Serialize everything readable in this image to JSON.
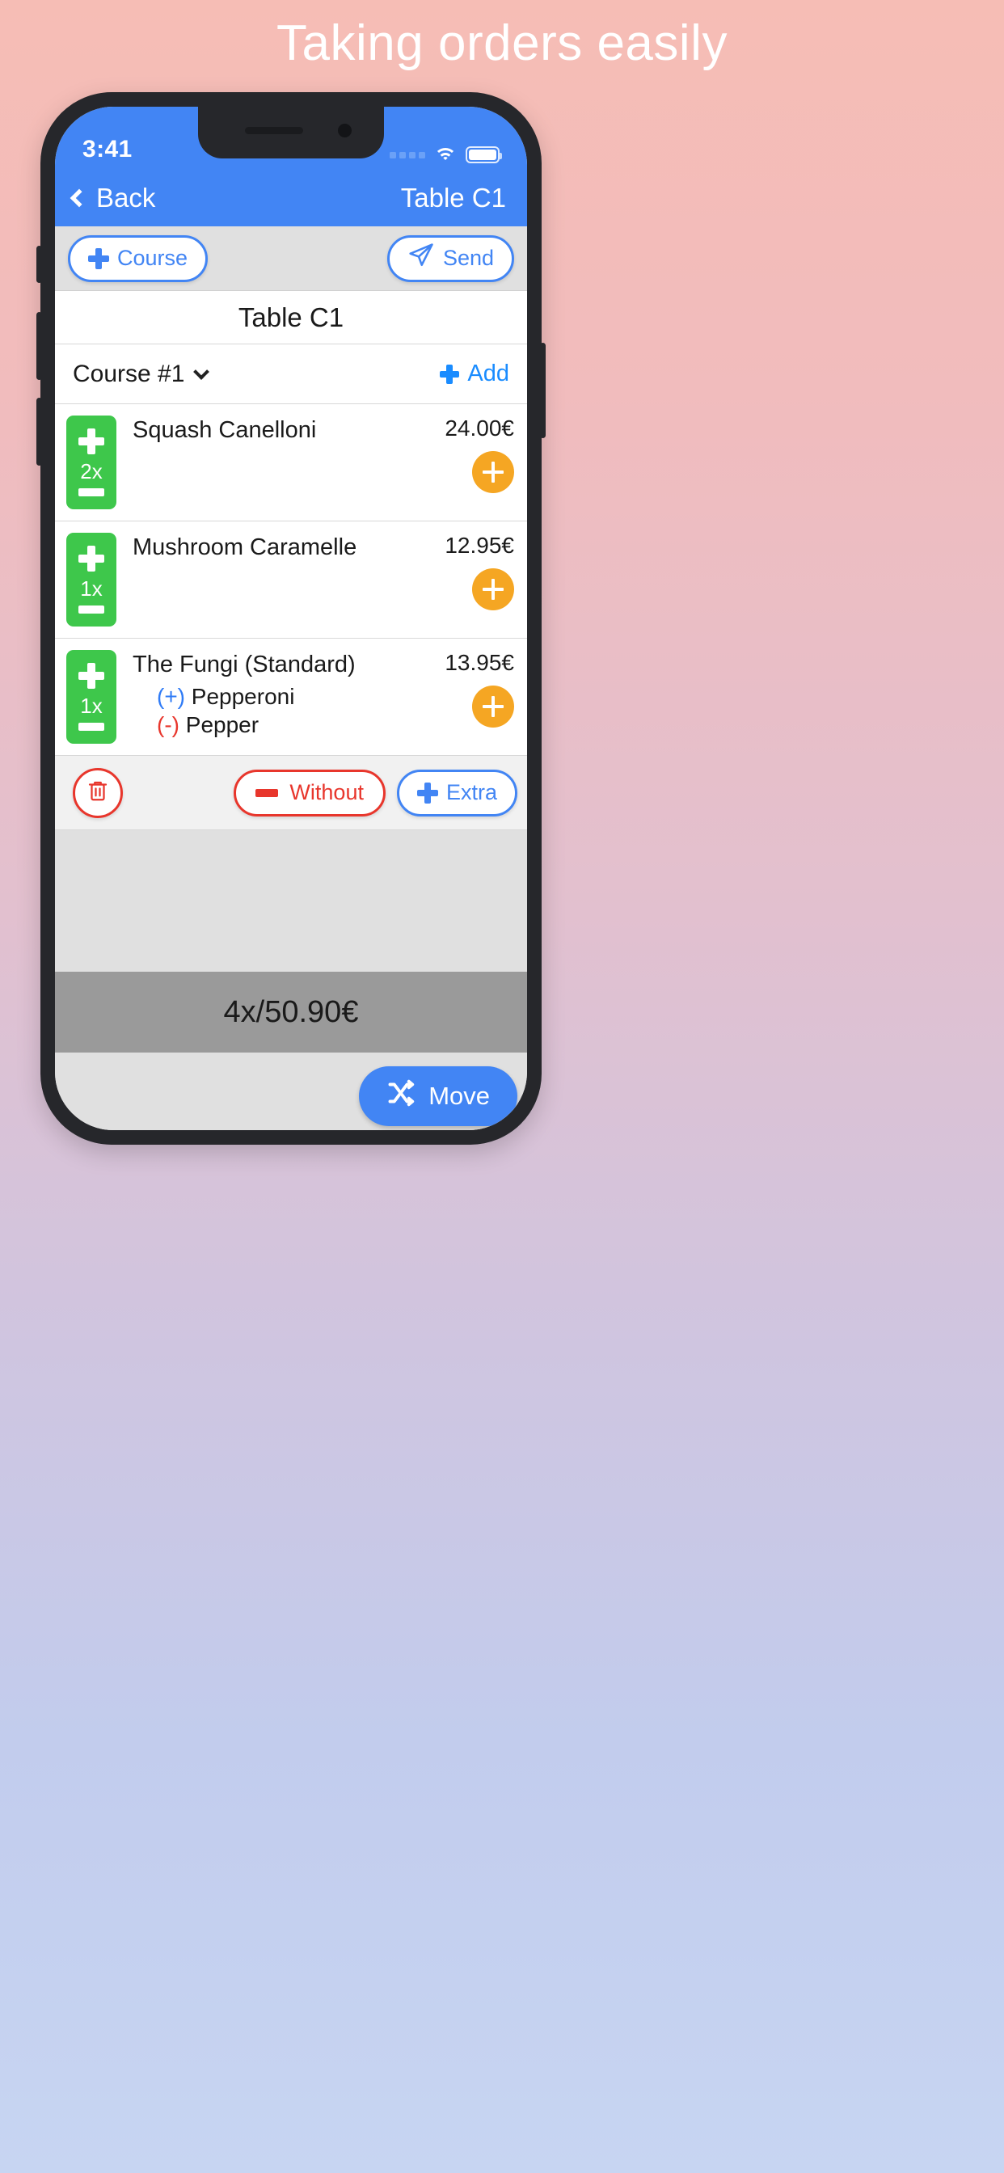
{
  "headline": "Taking orders easily",
  "status_bar": {
    "time": "3:41",
    "signal_icon": "signal-dots-icon",
    "wifi_icon": "wifi-icon",
    "battery_icon": "battery-full-icon"
  },
  "nav_bar": {
    "back_label": "Back",
    "back_icon": "chevron-left-icon",
    "title": "Table C1"
  },
  "toolbar": {
    "course_label": "Course",
    "course_icon": "plus-icon",
    "send_label": "Send",
    "send_icon": "paper-plane-icon"
  },
  "table_title": "Table C1",
  "course_row": {
    "label": "Course #1",
    "dropdown_icon": "chevron-down-icon",
    "add_label": "Add",
    "add_icon": "plus-icon"
  },
  "items": [
    {
      "name": "Squash Canelloni",
      "qty": "2x",
      "price": "24.00€",
      "mods": []
    },
    {
      "name": "Mushroom Caramelle",
      "qty": "1x",
      "price": "12.95€",
      "mods": []
    },
    {
      "name": "The Fungi (Standard)",
      "qty": "1x",
      "price": "13.95€",
      "mods": [
        {
          "sign": "(+)",
          "text": "Pepperoni",
          "type": "add"
        },
        {
          "sign": "(-)",
          "text": "Pepper",
          "type": "remove"
        }
      ]
    }
  ],
  "mod_bar": {
    "trash_icon": "trash-icon",
    "without_label": "Without",
    "without_icon": "minus-icon",
    "extra_label": "Extra",
    "extra_icon": "plus-icon"
  },
  "total": "4x/50.90€",
  "move_button": {
    "label": "Move",
    "icon": "shuffle-icon"
  },
  "colors": {
    "brand_blue": "#4285F4",
    "link_blue": "#1a8cff",
    "green": "#3ec74b",
    "orange": "#f5a623",
    "red": "#e8362c",
    "total_gray": "#9a9a9a"
  }
}
